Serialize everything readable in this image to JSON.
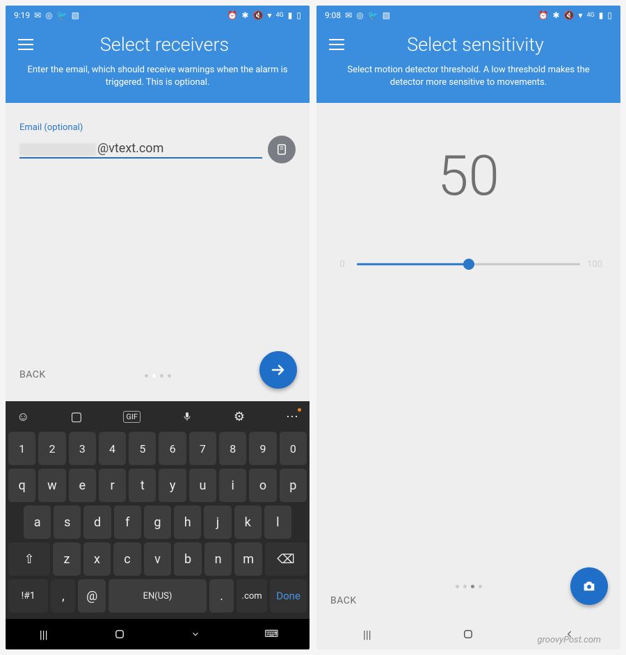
{
  "left": {
    "status": {
      "time": "9:19",
      "icons": [
        "gmail",
        "instagram",
        "twitter",
        "picture",
        "alarm",
        "bluetooth",
        "mute",
        "wifi",
        "4g",
        "signal",
        "battery"
      ]
    },
    "title": "Select receivers",
    "subtitle": "Enter the email, which should receive warnings when the alarm is triggered. This is optional.",
    "field_label": "Email (optional)",
    "email_value": "@vtext.com",
    "back": "BACK",
    "keyboard": {
      "row_num": [
        "1",
        "2",
        "3",
        "4",
        "5",
        "6",
        "7",
        "8",
        "9",
        "0"
      ],
      "row1": [
        "q",
        "w",
        "e",
        "r",
        "t",
        "y",
        "u",
        "i",
        "o",
        "p"
      ],
      "row2": [
        "a",
        "s",
        "d",
        "f",
        "g",
        "h",
        "j",
        "k",
        "l"
      ],
      "row3_shift": "⇧",
      "row3": [
        "z",
        "x",
        "c",
        "v",
        "b",
        "n",
        "m"
      ],
      "row3_bksp": "⌫",
      "row4": {
        "sym": "!#1",
        "comma": ",",
        "at": "@",
        "space": "EN(US)",
        "dot": ".",
        "com": ".com",
        "done": "Done"
      }
    }
  },
  "right": {
    "status": {
      "time": "9:08",
      "icons": [
        "gmail",
        "instagram",
        "twitter",
        "picture",
        "alarm",
        "bluetooth",
        "mute",
        "wifi",
        "4g",
        "signal",
        "battery"
      ]
    },
    "title": "Select sensitivity",
    "subtitle": "Select motion detector threshold. A low threshold makes the detector more sensitive to movements.",
    "value": "50",
    "slider": {
      "min": "0",
      "max": "100",
      "pos_pct": 50
    },
    "back": "BACK"
  },
  "watermark": "groovyPost.com"
}
